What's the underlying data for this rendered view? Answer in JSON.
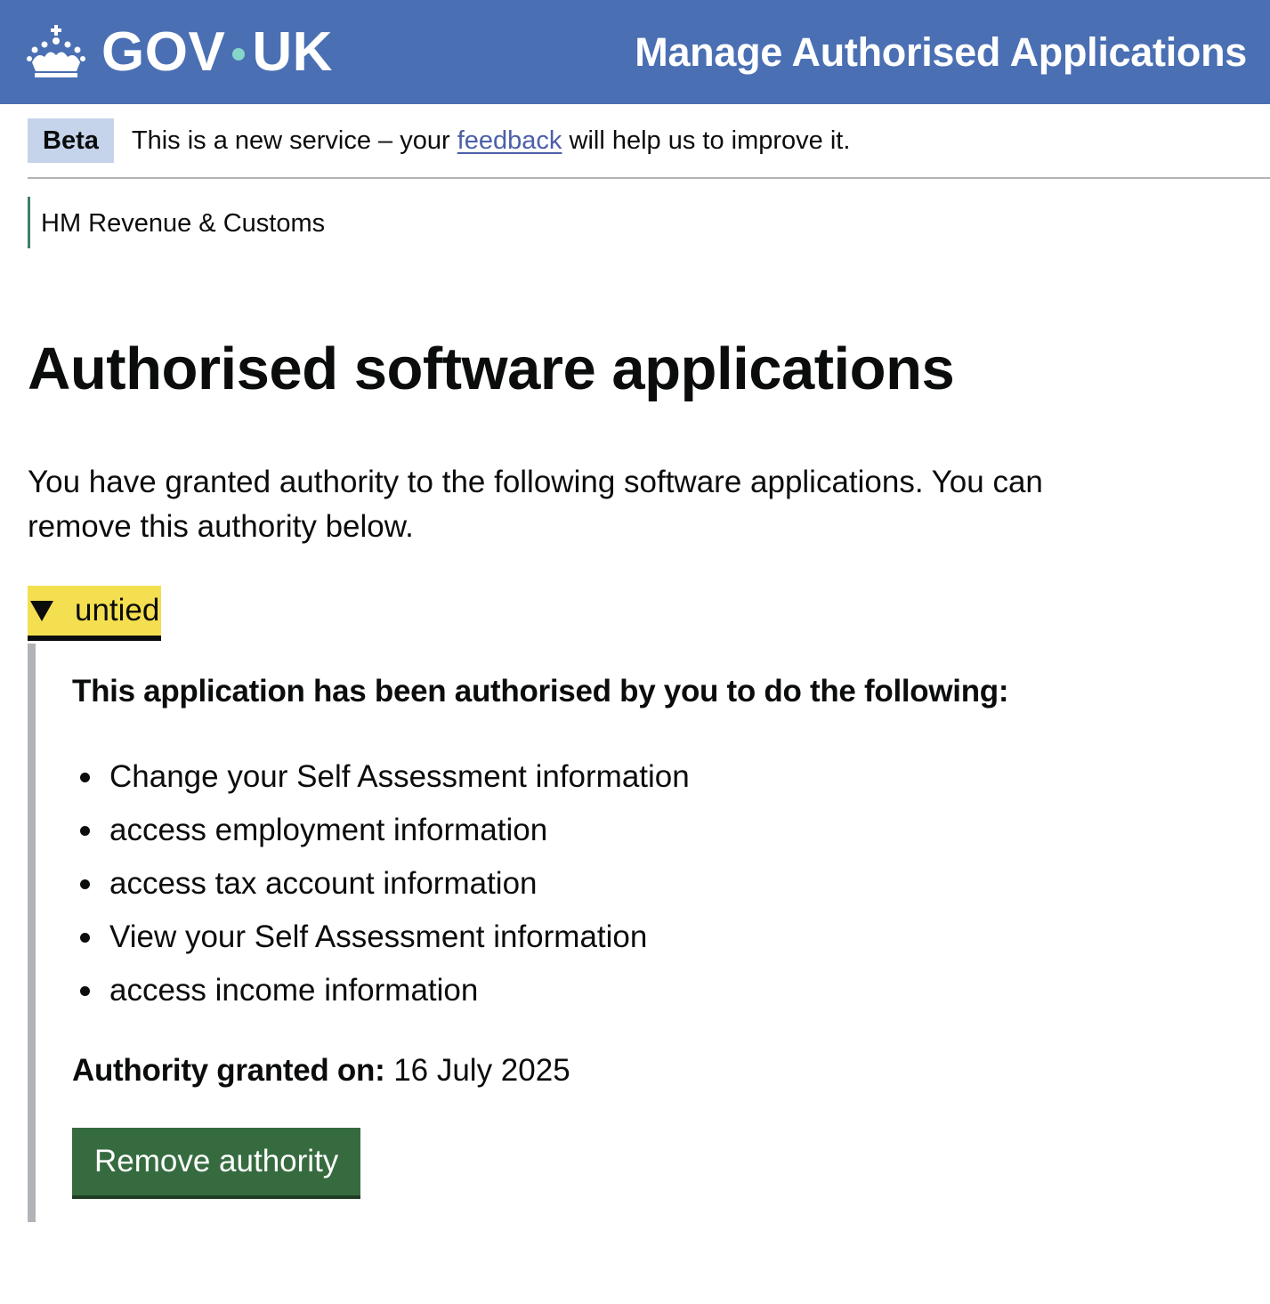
{
  "header": {
    "logo_left": "GOV",
    "logo_right": "UK",
    "service_name": "Manage Authorised Applications",
    "dot_color": "#84d6c9"
  },
  "phase_banner": {
    "tag": "Beta",
    "text_before": "This is a new service – your",
    "link": "feedback",
    "text_after": "will help us to improve it."
  },
  "organisation": "HM Revenue & Customs",
  "main": {
    "title": "Authorised software applications",
    "intro": "You have granted authority to the following software applications. You can remove this authority below.",
    "application": {
      "name": "untied",
      "heading": "This application has been authorised by you to do the following:",
      "scopes": [
        "Change your Self Assessment information",
        "access employment information",
        "access tax account information",
        "View your Self Assessment information",
        "access income information"
      ],
      "granted_label": "Authority granted on:",
      "granted_date": "16 July 2025",
      "remove_label": "Remove authority"
    }
  },
  "icons": {
    "logo": "crown-icon",
    "expander": "triangle-down-icon"
  }
}
